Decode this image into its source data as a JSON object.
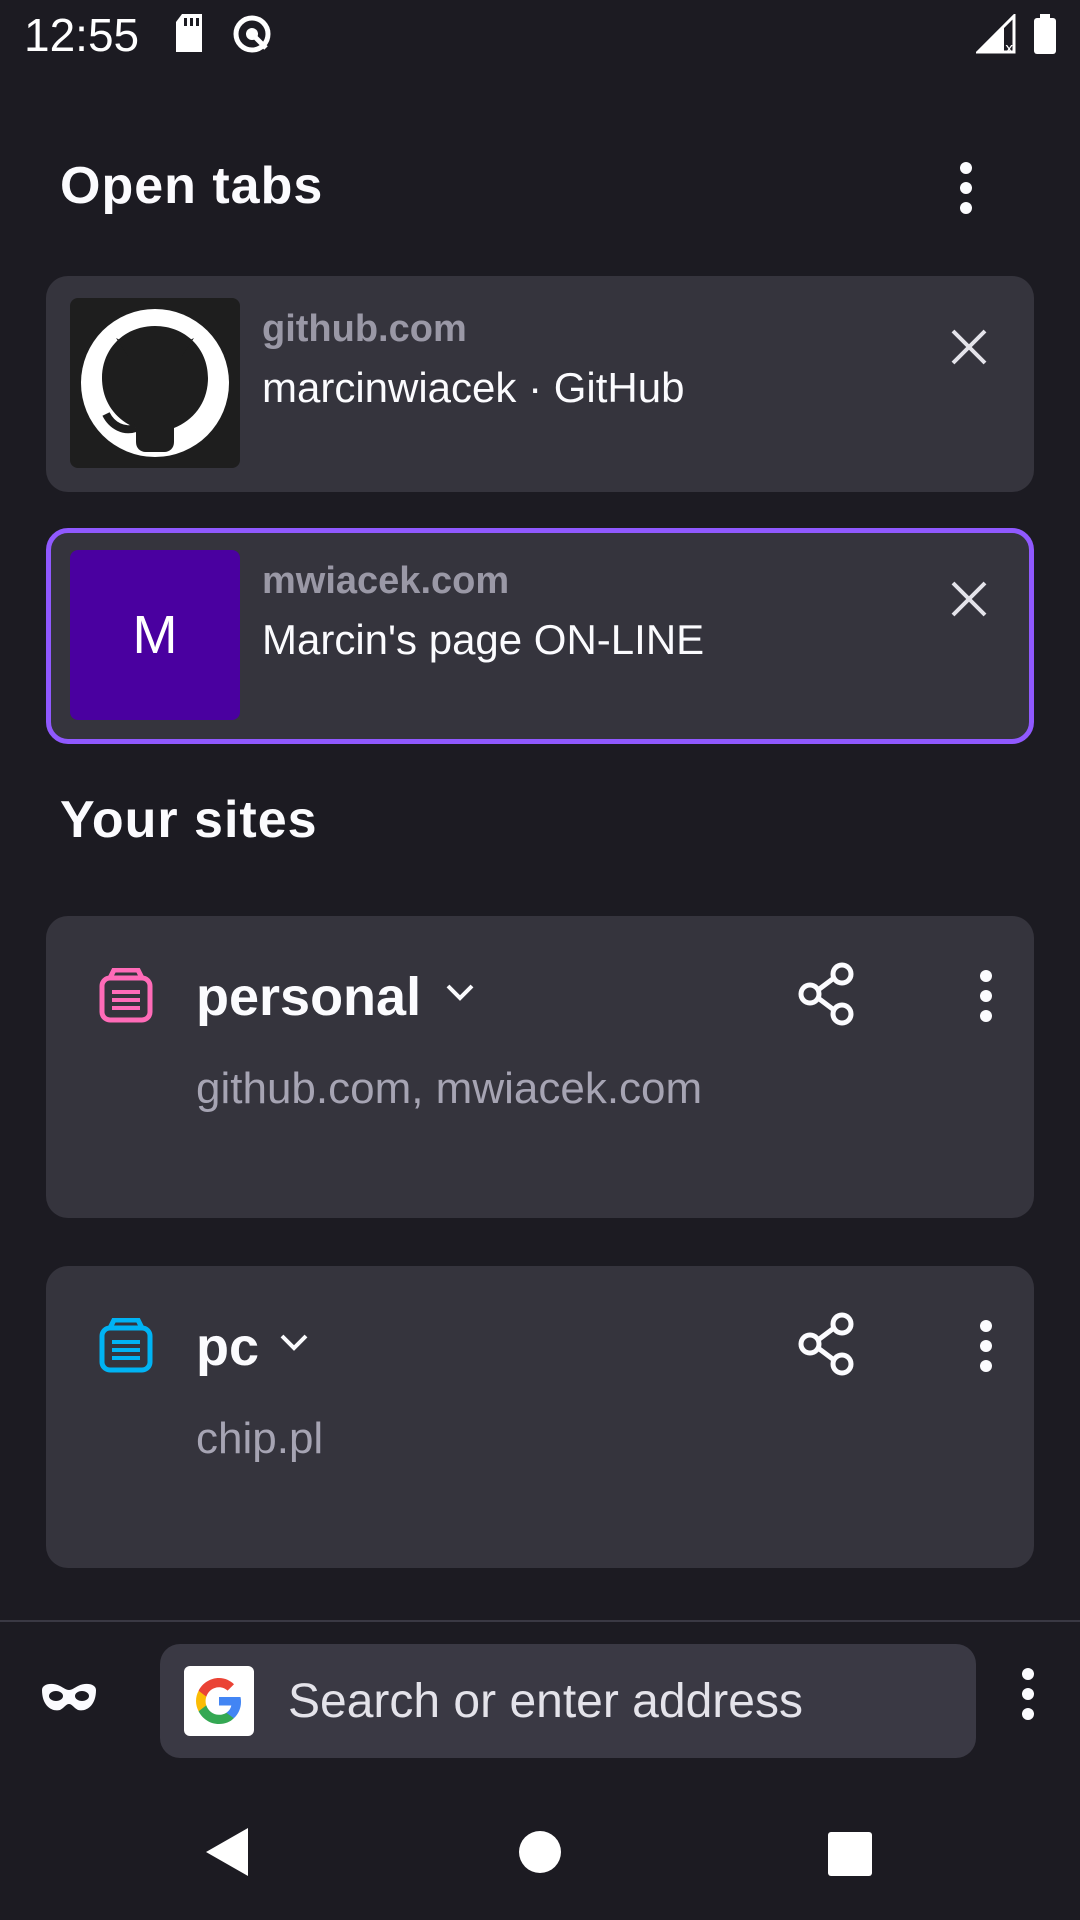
{
  "status_bar": {
    "time": "12:55"
  },
  "open_tabs": {
    "title": "Open tabs",
    "tabs": [
      {
        "domain": "github.com",
        "title": "marcinwiacek · GitHub",
        "selected": false
      },
      {
        "domain": "mwiacek.com",
        "title": "Marcin's page ON-LINE",
        "selected": true,
        "thumb_letter": "M",
        "thumb_color": "#4a00a0"
      }
    ]
  },
  "your_sites": {
    "title": "Your sites",
    "collections": [
      {
        "name": "personal",
        "tabs": "github.com, mwiacek.com",
        "icon_color": "#ff6bb8"
      },
      {
        "name": "pc",
        "tabs": "chip.pl",
        "icon_color": "#00b3f4"
      }
    ]
  },
  "toolbar": {
    "search_placeholder": "Search or enter address"
  },
  "colors": {
    "background": "#1c1b22",
    "card": "#35343d",
    "accent": "#9059ff"
  }
}
